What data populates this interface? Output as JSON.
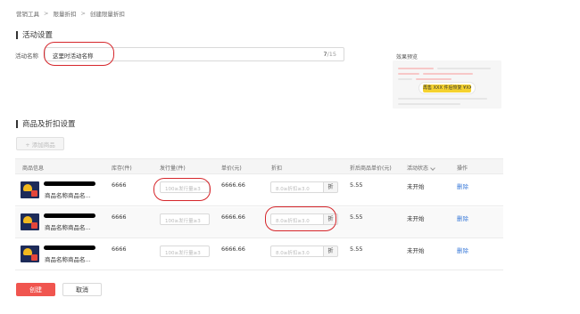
{
  "breadcrumb": [
    "营销工具",
    "限量折扣",
    "创建限量折扣"
  ],
  "sections": {
    "activity_settings": "活动设置",
    "product_discount": "商品及折扣设置"
  },
  "activity_name": {
    "label": "活动名称",
    "value": "这里时活动名称",
    "count_current": "7",
    "count_max": "/15"
  },
  "preview": {
    "label": "效果预览",
    "promo_text": "再售 XXX 件后恢复 ¥XXX"
  },
  "add_product_button": "+ 添加商品",
  "table": {
    "headers": [
      "商品信息",
      "库存(件)",
      "发行量(件)",
      "单价(元)",
      "折扣",
      "折后商品单价(元)",
      "活动状态",
      "操作"
    ],
    "rows": [
      {
        "name": "商品名称商品名...",
        "stock": "6666",
        "qty_placeholder": "100≥发行量≥3",
        "price": "6666.66",
        "discount_placeholder": "8.0≥折扣≥3.0",
        "discount_unit": "折",
        "discounted_price": "5.55",
        "status": "未开始",
        "action": "删除"
      },
      {
        "name": "商品名称商品名...",
        "stock": "6666",
        "qty_placeholder": "100≥发行量≥3",
        "price": "6666.66",
        "discount_placeholder": "8.0≥折扣≥3.0",
        "discount_unit": "折",
        "discounted_price": "5.55",
        "status": "未开始",
        "action": "删除"
      },
      {
        "name": "商品名称商品名...",
        "stock": "6666",
        "qty_placeholder": "100≥发行量≥3",
        "price": "6666.66",
        "discount_placeholder": "8.0≥折扣≥3.0",
        "discount_unit": "折",
        "discounted_price": "5.55",
        "status": "未开始",
        "action": "删除"
      }
    ]
  },
  "buttons": {
    "create": "创建",
    "cancel": "取消"
  },
  "colors": {
    "primary_red": "#f0554f",
    "link_blue": "#3a7ad9",
    "annotation_red": "#d6262b",
    "promo_yellow": "#f5d22e"
  }
}
